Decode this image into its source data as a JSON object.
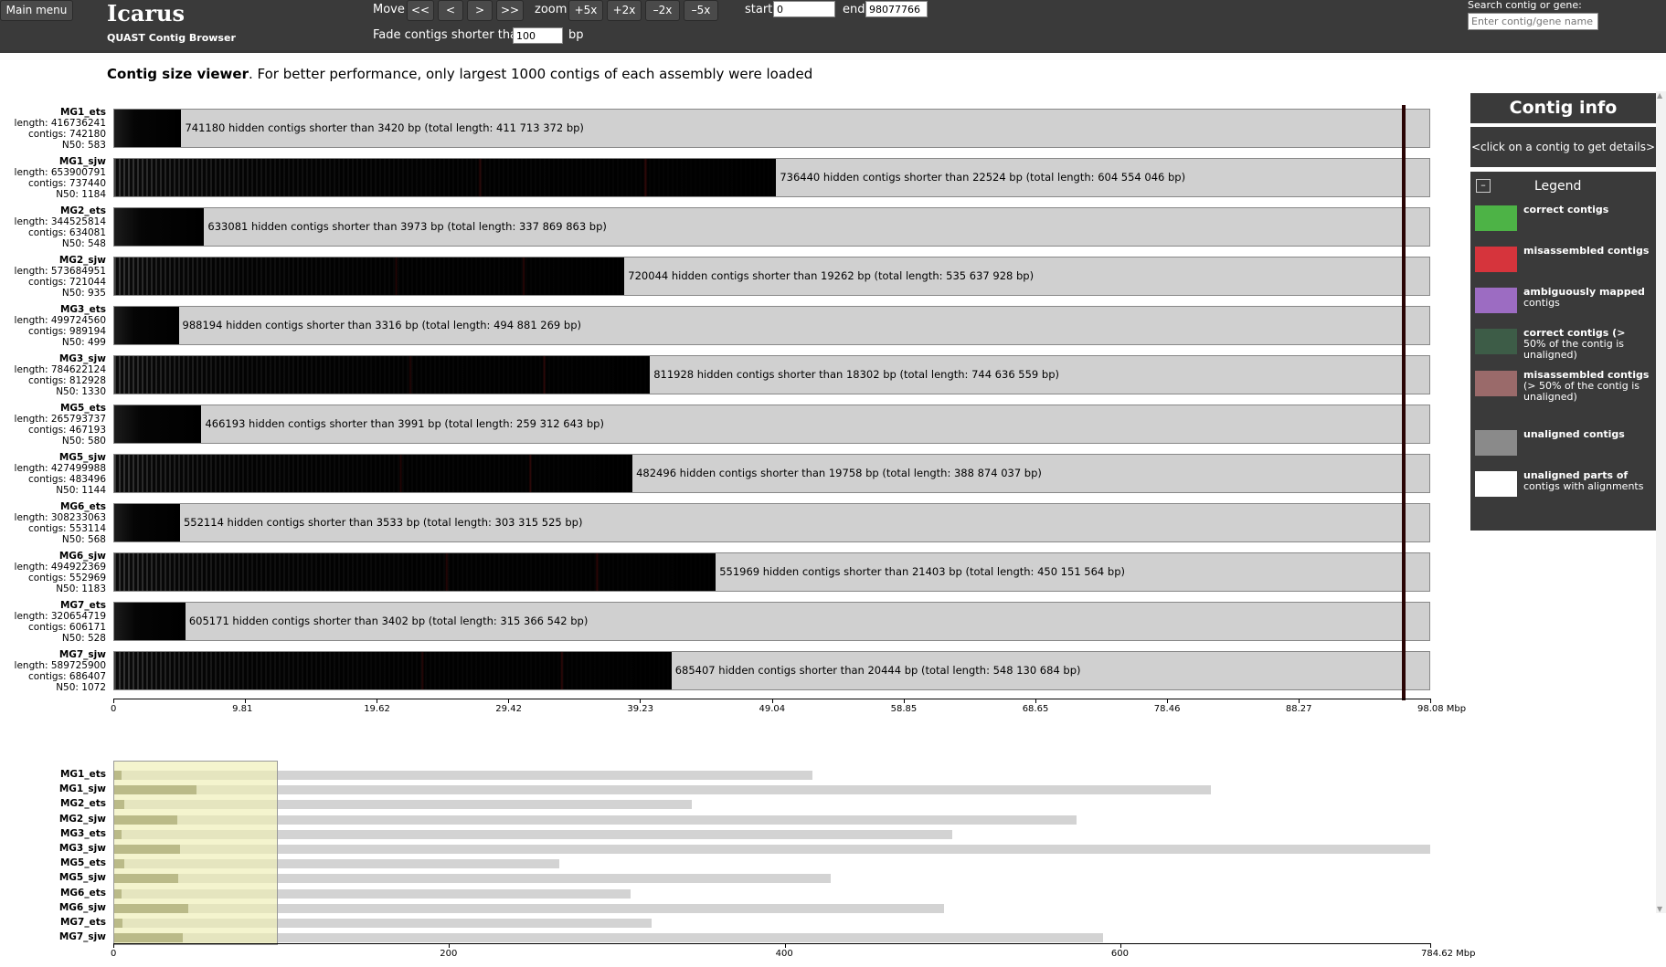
{
  "app": {
    "title": "Icarus",
    "subtitle": "QUAST Contig Browser"
  },
  "toolbar": {
    "main_menu": "Main menu",
    "move_label": "Move",
    "move_far_left": "<<",
    "move_left": "<",
    "move_right": ">",
    "move_far_right": ">>",
    "zoom_label": "zoom",
    "zoom_in5": "+5x",
    "zoom_in2": "+2x",
    "zoom_out2": "–2x",
    "zoom_out5": "–5x",
    "start_label": "start",
    "start_value": "0",
    "end_label": "end",
    "end_value": "98077766",
    "fade_label": "Fade contigs shorter than",
    "fade_value": "100",
    "fade_unit": "bp",
    "search_label": "Search contig or gene:",
    "search_placeholder": "Enter contig/gene name"
  },
  "viewer": {
    "title_bold": "Contig size viewer",
    "title_rest": ". For better performance, only largest 1000 contigs of each assembly were loaded"
  },
  "assemblies": [
    {
      "name": "MG1_ets",
      "length": "length: 416736241",
      "contigs": "contigs: 742180",
      "n50": "N50: 583",
      "visible_mbp": 5.0,
      "style": "solid",
      "hidden": "741180 hidden contigs shorter than 3420 bp (total length: 411 713 372 bp)",
      "total_mbp": 416.74
    },
    {
      "name": "MG1_sjw",
      "length": "length: 653900791",
      "contigs": "contigs: 737440",
      "n50": "N50: 1184",
      "visible_mbp": 49.3,
      "style": "striped",
      "hidden": "736440 hidden contigs shorter than 22524 bp (total length: 604 554 046 bp)",
      "total_mbp": 653.9
    },
    {
      "name": "MG2_ets",
      "length": "length: 344525814",
      "contigs": "contigs: 634081",
      "n50": "N50: 548",
      "visible_mbp": 6.7,
      "style": "solid",
      "hidden": "633081 hidden contigs shorter than 3973 bp (total length: 337 869 863 bp)",
      "total_mbp": 344.53
    },
    {
      "name": "MG2_sjw",
      "length": "length: 573684951",
      "contigs": "contigs: 721044",
      "n50": "N50: 935",
      "visible_mbp": 38.0,
      "style": "striped",
      "hidden": "720044 hidden contigs shorter than 19262 bp (total length: 535 637 928 bp)",
      "total_mbp": 573.68
    },
    {
      "name": "MG3_ets",
      "length": "length: 499724560",
      "contigs": "contigs: 989194",
      "n50": "N50: 499",
      "visible_mbp": 4.8,
      "style": "solid",
      "hidden": "988194 hidden contigs shorter than 3316 bp (total length: 494 881 269 bp)",
      "total_mbp": 499.72
    },
    {
      "name": "MG3_sjw",
      "length": "length: 784622124",
      "contigs": "contigs: 812928",
      "n50": "N50: 1330",
      "visible_mbp": 39.9,
      "style": "striped",
      "hidden": "811928 hidden contigs shorter than 18302 bp (total length: 744 636 559 bp)",
      "total_mbp": 784.62
    },
    {
      "name": "MG5_ets",
      "length": "length: 265793737",
      "contigs": "contigs: 467193",
      "n50": "N50: 580",
      "visible_mbp": 6.5,
      "style": "solid",
      "hidden": "466193 hidden contigs shorter than 3991 bp (total length: 259 312 643 bp)",
      "total_mbp": 265.79
    },
    {
      "name": "MG5_sjw",
      "length": "length: 427499988",
      "contigs": "contigs: 483496",
      "n50": "N50: 1144",
      "visible_mbp": 38.6,
      "style": "striped",
      "hidden": "482496 hidden contigs shorter than 19758 bp (total length: 388 874 037 bp)",
      "total_mbp": 427.5
    },
    {
      "name": "MG6_ets",
      "length": "length: 308233063",
      "contigs": "contigs: 553114",
      "n50": "N50: 568",
      "visible_mbp": 4.9,
      "style": "solid",
      "hidden": "552114 hidden contigs shorter than 3533 bp (total length: 303 315 525 bp)",
      "total_mbp": 308.23
    },
    {
      "name": "MG6_sjw",
      "length": "length: 494922369",
      "contigs": "contigs: 552969",
      "n50": "N50: 1183",
      "visible_mbp": 44.8,
      "style": "striped",
      "hidden": "551969 hidden contigs shorter than 21403 bp (total length: 450 151 564 bp)",
      "total_mbp": 494.92
    },
    {
      "name": "MG7_ets",
      "length": "length: 320654719",
      "contigs": "contigs: 606171",
      "n50": "N50: 528",
      "visible_mbp": 5.3,
      "style": "solid",
      "hidden": "605171 hidden contigs shorter than 3402 bp (total length: 315 366 542 bp)",
      "total_mbp": 320.65
    },
    {
      "name": "MG7_sjw",
      "length": "length: 589725900",
      "contigs": "contigs: 686407",
      "n50": "N50: 1072",
      "visible_mbp": 41.5,
      "style": "striped",
      "hidden": "685407 hidden contigs shorter than 20444 bp (total length: 548 130 684 bp)",
      "total_mbp": 589.73
    }
  ],
  "main_axis": {
    "max": 98.08,
    "ticks": [
      "0",
      "9.81",
      "19.62",
      "29.42",
      "39.23",
      "49.04",
      "58.85",
      "68.65",
      "78.46",
      "88.27",
      "98.08 Mbp"
    ],
    "cursor_mbp": 96.0
  },
  "overview_axis": {
    "max": 784.62,
    "ticks": [
      "0",
      "200",
      "400",
      "600",
      "784.62 Mbp"
    ],
    "tick_values": [
      0,
      200,
      400,
      600,
      784.62
    ],
    "brush_end_mbp": 98.08
  },
  "panel": {
    "title": "Contig info",
    "hint": "<click on a contig to get details>",
    "legend_title": "Legend",
    "collapse": "–"
  },
  "legend": [
    {
      "bold": "correct contigs",
      "rest": "",
      "color": "#4db346"
    },
    {
      "bold": "misassembled contigs",
      "rest": "",
      "color": "#d6343c"
    },
    {
      "bold": "ambiguously mapped",
      "rest": "contigs",
      "color": "#9c6cc2"
    },
    {
      "bold": "correct contigs (>",
      "rest": "50% of the contig is unaligned)",
      "color": "#3d5c47"
    },
    {
      "bold": "misassembled contigs",
      "rest": "(> 50% of the contig is unaligned)",
      "color": "#9a6a6a"
    },
    {
      "bold": "unaligned contigs",
      "rest": "",
      "color": "#8a8a8a"
    },
    {
      "bold": "unaligned parts of",
      "rest": "contigs with alignments",
      "color": "#ffffff"
    }
  ]
}
